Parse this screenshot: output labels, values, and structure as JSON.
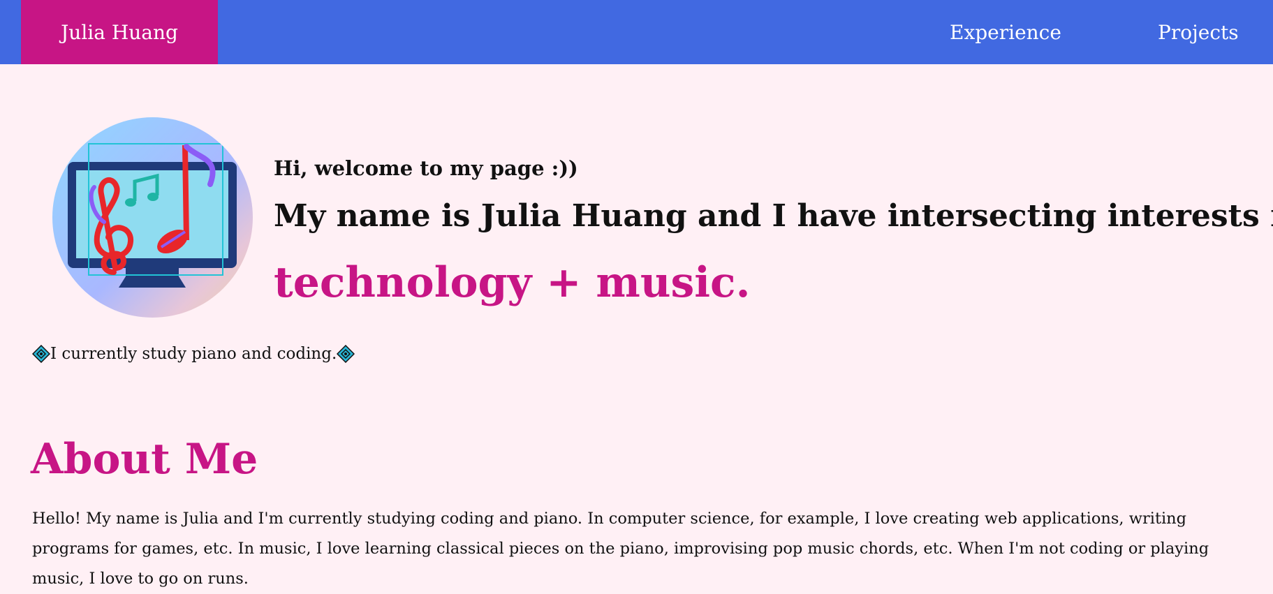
{
  "nav": {
    "brand": "Julia Huang",
    "links": [
      "Experience",
      "Projects"
    ]
  },
  "hero": {
    "welcome": "Hi, welcome to my page :))",
    "headline": "My name is Julia Huang and I have intersecting interests in",
    "highlight": "technology + music.",
    "avatar_icon": "computer-music-icon"
  },
  "study": {
    "text": "I currently study piano and coding.",
    "icon": "diamond-icon"
  },
  "about": {
    "title": "About Me",
    "body": "Hello! My name is Julia and I'm currently studying coding and piano. In computer science, for example, I love creating web applications, writing programs for games, etc. In music, I love learning classical pieces on the piano, improvising pop music chords, etc. When I'm not coding or playing music, I love to go on runs."
  },
  "colors": {
    "nav_bg": "#4169e1",
    "brand_bg": "#c71585",
    "accent": "#c71585",
    "page_bg": "#fff0f5"
  }
}
